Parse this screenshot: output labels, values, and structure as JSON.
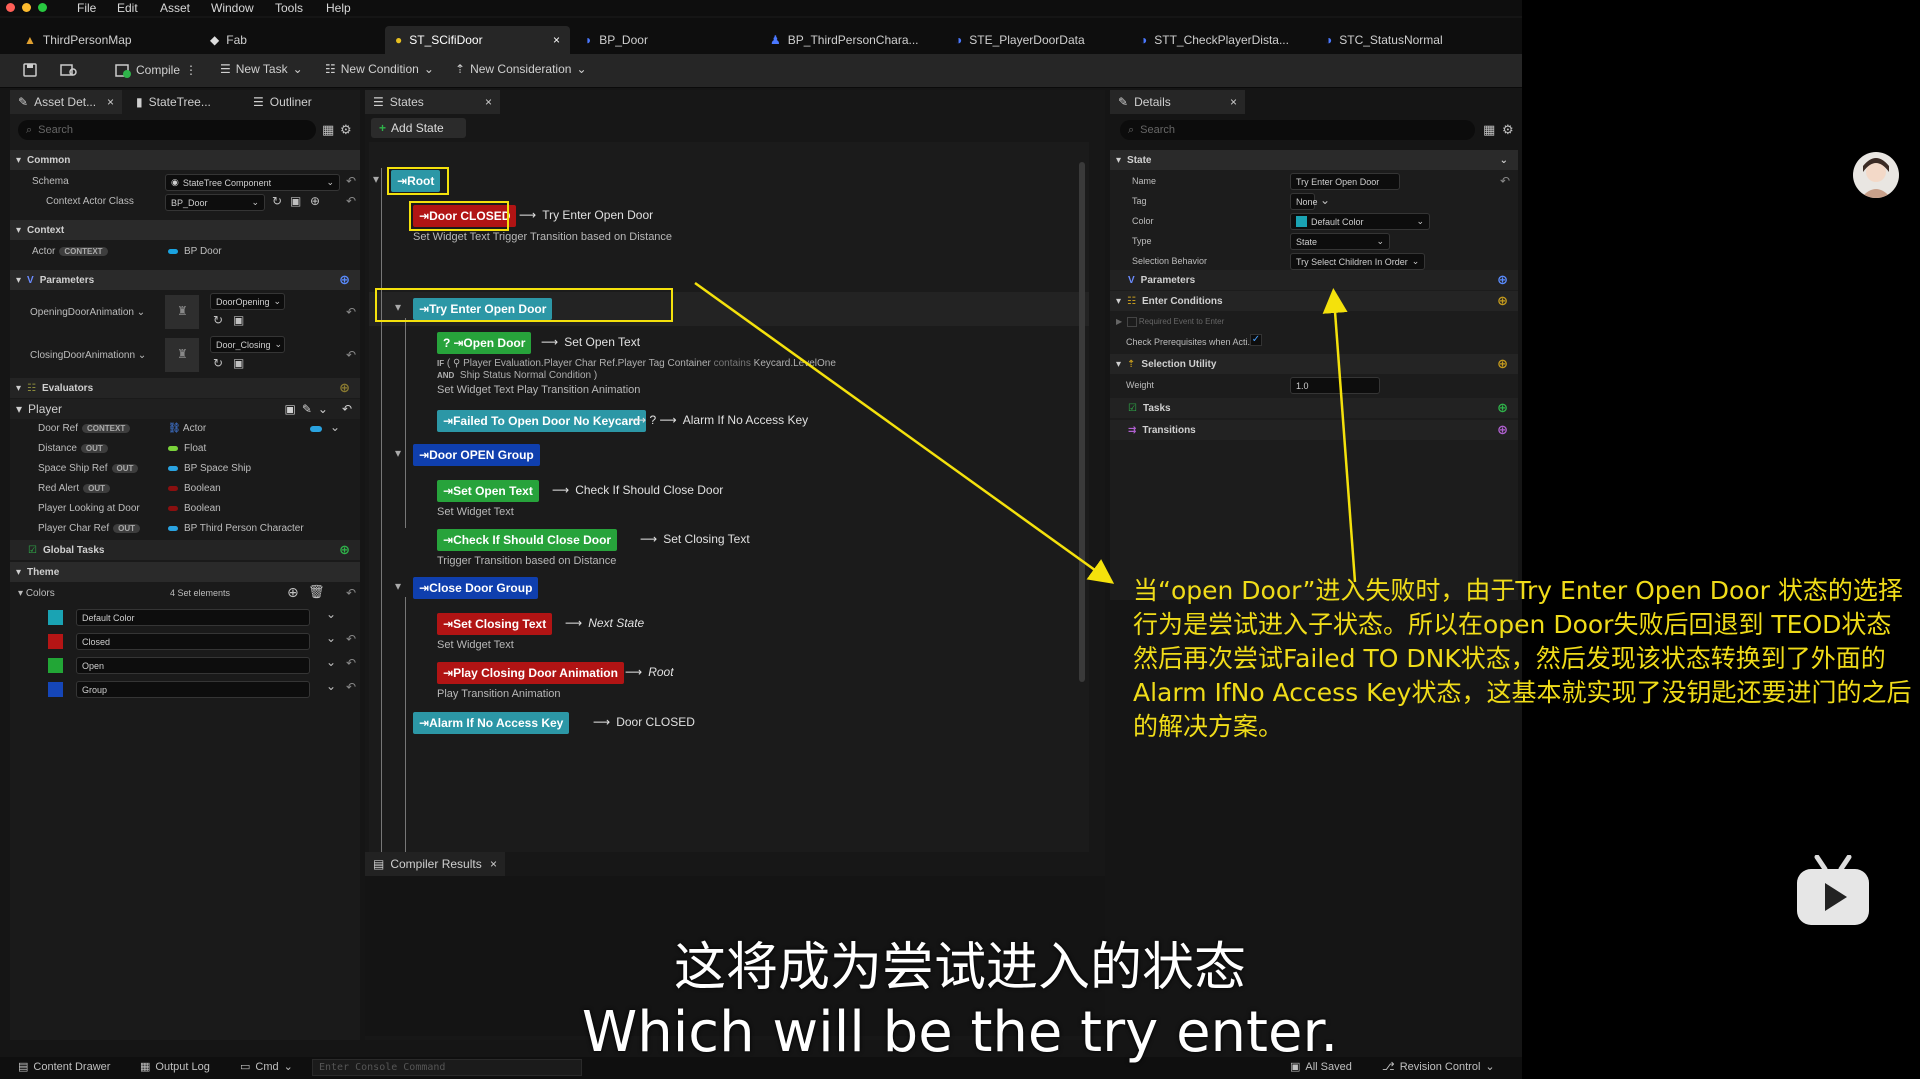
{
  "menu": [
    "File",
    "Edit",
    "Asset",
    "Window",
    "Tools",
    "Help"
  ],
  "doc_tabs": [
    {
      "label": "ThirdPersonMap"
    },
    {
      "label": "Fab"
    },
    {
      "label": "ST_SCifiDoor",
      "close": "×"
    },
    {
      "label": "BP_Door"
    },
    {
      "label": "BP_ThirdPersonChara..."
    },
    {
      "label": "STE_PlayerDoorData"
    },
    {
      "label": "STT_CheckPlayerDista..."
    },
    {
      "label": "STC_StatusNormal"
    }
  ],
  "toolbar": {
    "compile": "Compile",
    "new_task": "New Task",
    "new_condition": "New Condition",
    "new_consideration": "New Consideration"
  },
  "left": {
    "tabs": [
      "Asset Det...",
      "StateTree...",
      "Outliner"
    ],
    "search_placeholder": "Search",
    "common": "Common",
    "schema_label": "Schema",
    "schema_value": "StateTree Component",
    "context_actor_class_label": "Context Actor Class",
    "context_actor_class_value": "BP_Door",
    "context": "Context",
    "actor_label": "Actor",
    "context_pill": "CONTEXT",
    "actor_value": "BP Door",
    "parameters": "Parameters",
    "opening_label": "OpeningDoorAnimation",
    "opening_value": "DoorOpening",
    "closing_label": "ClosingDoorAnimationn",
    "closing_value": "Door_Closing",
    "evaluators": "Evaluators",
    "player": "Player",
    "player_rows": [
      {
        "label": "Door Ref",
        "pill": "CONTEXT",
        "value": "Actor"
      },
      {
        "label": "Distance",
        "pill": "OUT",
        "value": "Float"
      },
      {
        "label": "Space Ship Ref",
        "pill": "OUT",
        "value": "BP Space Ship"
      },
      {
        "label": "Red Alert",
        "pill": "OUT",
        "value": "Boolean"
      },
      {
        "label": "Player Looking at Door",
        "pill": "",
        "value": "Boolean"
      },
      {
        "label": "Player Char Ref",
        "pill": "OUT",
        "value": "BP Third Person Character"
      }
    ],
    "global_tasks": "Global Tasks",
    "theme": "Theme",
    "colors_label": "Colors",
    "colors_count": "4 Set elements",
    "colors": [
      {
        "name": "Default Color",
        "swatch": "#1aa3b3"
      },
      {
        "name": "Closed",
        "swatch": "#b51515"
      },
      {
        "name": "Open",
        "swatch": "#22a636"
      },
      {
        "name": "Group",
        "swatch": "#1546b8"
      }
    ]
  },
  "states": {
    "tab": "States",
    "add_state": "Add State",
    "root": "Root",
    "door_closed": "Door CLOSED",
    "door_closed_trans": "Try Enter Open Door",
    "door_closed_sub": "Set Widget Text   Trigger Transition based on Distance",
    "try_enter": "Try Enter Open Door",
    "open_door": "Open Door",
    "open_door_q": "?",
    "open_door_trans": "Set Open Text",
    "cond_if": "IF",
    "cond_line1": "Player Evaluation.Player Char Ref.Player Tag Container",
    "cond_contains": "contains",
    "cond_key": "Keycard.LevelOne",
    "cond_and": "AND",
    "cond_line2": "Ship Status Normal Condition )",
    "open_door_sub": "Set Widget Text   Play Transition Animation",
    "failed": "Failed To  Open Door No Keycard",
    "failed_trans": "Alarm If No Access Key",
    "door_open_group": "Door OPEN Group",
    "set_open_text": "Set Open Text",
    "set_open_trans": "Check If Should Close Door",
    "set_open_sub": "Set Widget Text",
    "check_close": "Check If Should Close Door",
    "check_close_trans": "Set Closing Text",
    "check_close_sub": "Trigger Transition based on Distance",
    "close_door_group": "Close Door Group",
    "set_closing": "Set Closing Text",
    "set_closing_trans": "Next State",
    "set_closing_sub": "Set Widget Text",
    "play_closing": "Play Closing Door Animation",
    "play_closing_trans": "Root",
    "play_closing_sub": "Play Transition Animation",
    "alarm": "Alarm If No Access Key",
    "alarm_trans": "Door CLOSED",
    "compiler_results": "Compiler Results"
  },
  "details": {
    "tab": "Details",
    "search_placeholder": "Search",
    "state": "State",
    "name_label": "Name",
    "name_value": "Try Enter Open Door",
    "tag_label": "Tag",
    "tag_value": "None",
    "color_label": "Color",
    "color_value": "Default Color",
    "type_label": "Type",
    "type_value": "State",
    "selection_label": "Selection Behavior",
    "selection_value": "Try Select Children In Order",
    "parameters": "Parameters",
    "enter_conditions": "Enter Conditions",
    "required_event": "Required Event to Enter",
    "check_prereq": "Check Prerequisites when Acti...",
    "selection_utility": "Selection Utility",
    "weight_label": "Weight",
    "weight_value": "1.0",
    "tasks": "Tasks",
    "transitions": "Transitions"
  },
  "bottom": {
    "content_drawer": "Content Drawer",
    "output_log": "Output Log",
    "cmd": "Cmd",
    "console_placeholder": "Enter Console Command",
    "all_saved": "All Saved",
    "revision_control": "Revision Control"
  },
  "annotation": "当“open Door”进入失败时，由于Try Enter Open Door 状态的选择行为是尝试进入子状态。所以在open Door失败后回退到 TEOD状态然后再次尝试Failed TO DNK状态，然后发现该状态转换到了外面的Alarm IfNo Access Key状态，这基本就实现了没钥匙还要进门的之后的解决方案。",
  "subtitle_cn": "这将成为尝试进入的状态",
  "subtitle_en": "Which will be the try enter."
}
